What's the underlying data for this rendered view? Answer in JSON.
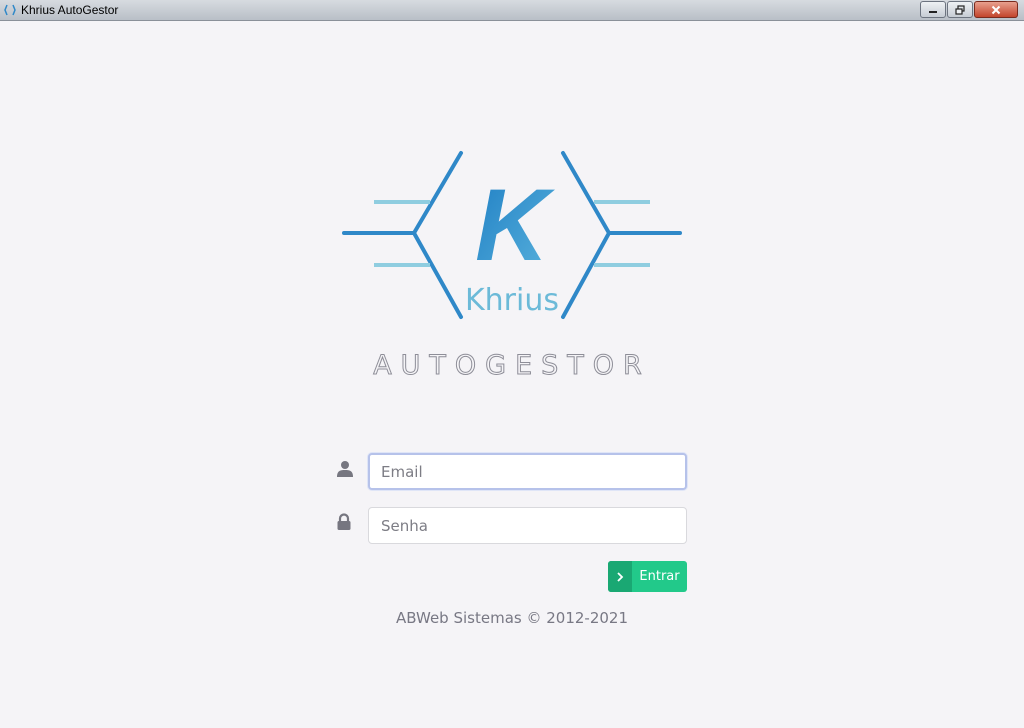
{
  "window": {
    "title": "Khrius AutoGestor"
  },
  "logo": {
    "letter": "K",
    "brand": "Khrius",
    "product": "AUTOGESTOR"
  },
  "form": {
    "email_placeholder": "Email",
    "password_placeholder": "Senha",
    "email_value": "",
    "password_value": "",
    "submit_label": "Entrar"
  },
  "footer": {
    "text": "ABWeb Sistemas © 2012-2021"
  },
  "colors": {
    "background": "#f5f4f7",
    "logo_blue": "#2f88c8",
    "logo_light_blue": "#8fcde0",
    "submit_green": "#22c98a",
    "submit_green_dark": "#1aa873"
  },
  "icons": {
    "email_field": "user-icon",
    "password_field": "lock-icon",
    "submit": "chevron-right-icon"
  }
}
